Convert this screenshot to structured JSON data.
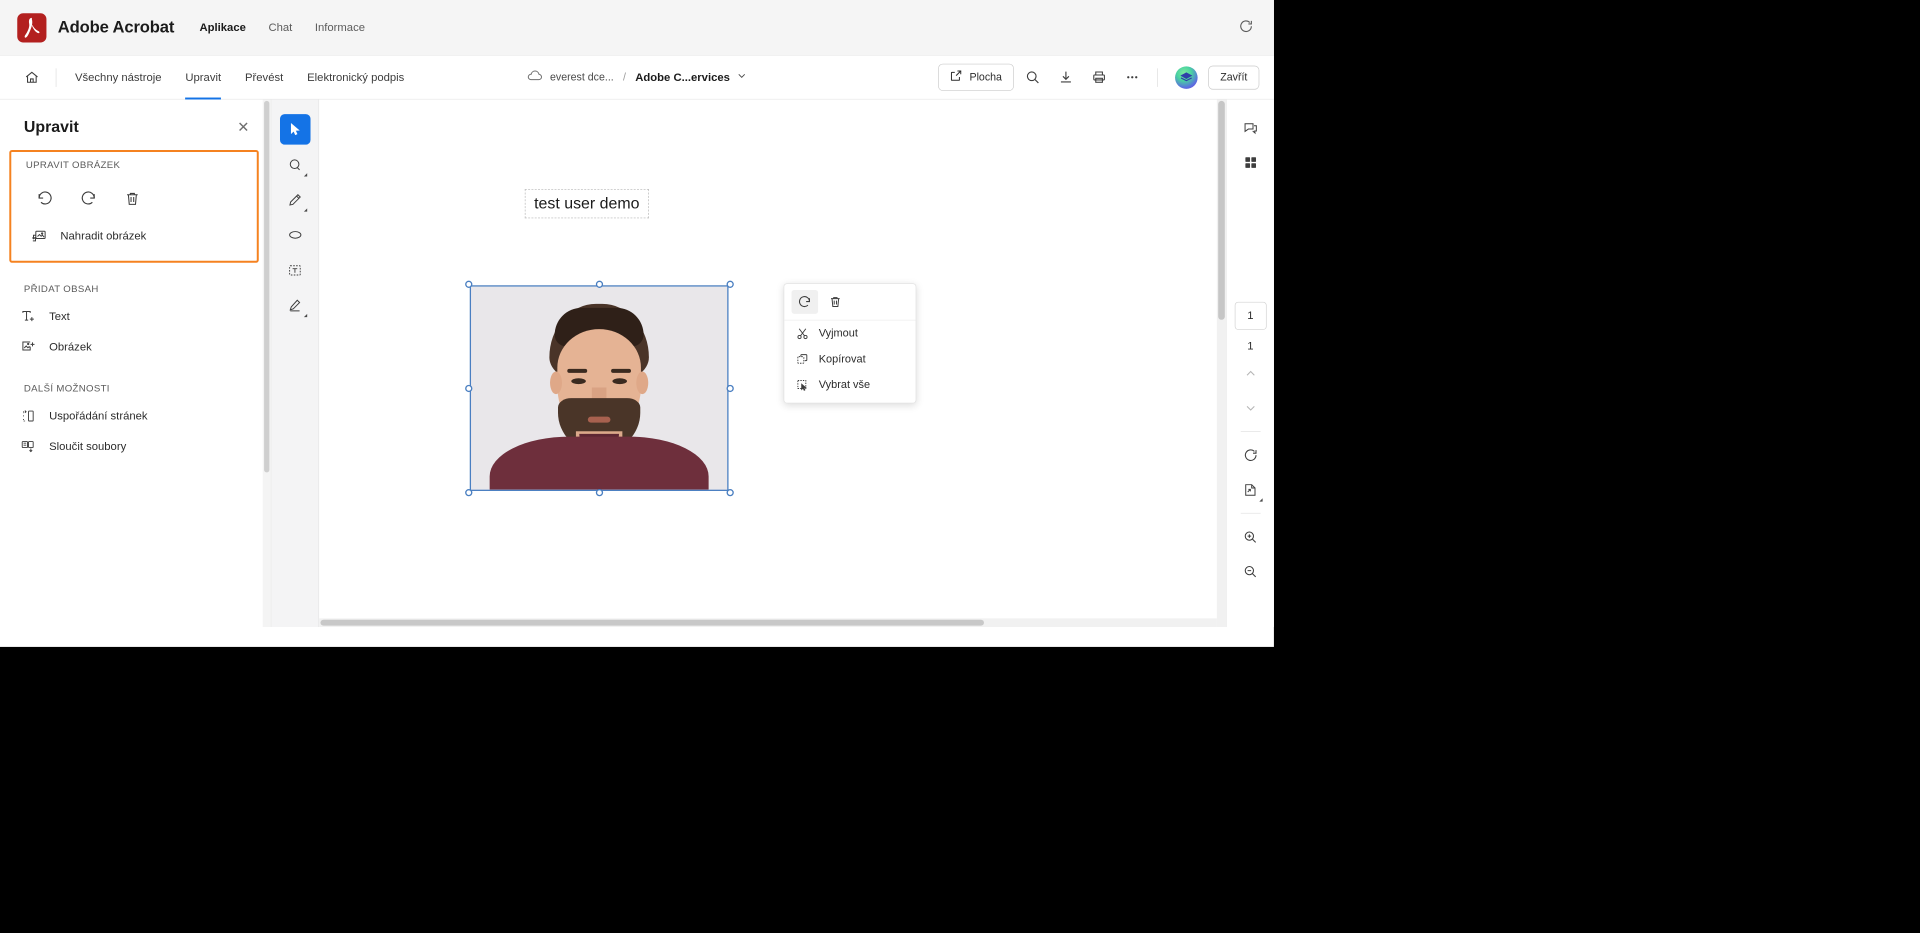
{
  "brand": {
    "logo_icon": "acrobat-logo-icon",
    "title": "Adobe Acrobat",
    "tabs": [
      {
        "label": "Aplikace",
        "active": true
      },
      {
        "label": "Chat",
        "active": false
      },
      {
        "label": "Informace",
        "active": false
      }
    ],
    "refresh_icon": "refresh-icon"
  },
  "toolbar": {
    "home_icon": "home-icon",
    "menu": [
      {
        "label": "Všechny nástroje",
        "active": false
      },
      {
        "label": "Upravit",
        "active": true
      },
      {
        "label": "Převést",
        "active": false
      },
      {
        "label": "Elektronický podpis",
        "active": false
      }
    ],
    "cloud_icon": "cloud-icon",
    "cloud_name": "everest dce...",
    "separator": "/",
    "doc_name": "Adobe C...ervices",
    "doc_caret_icon": "chevron-down-icon",
    "desktop_button": {
      "label": "Plocha",
      "icon": "open-external-icon"
    },
    "search_icon": "search-icon",
    "download_icon": "download-icon",
    "print_icon": "print-icon",
    "more_icon": "more-horizontal-icon",
    "avatar_icon": "user-avatar",
    "close_button": "Zavřít"
  },
  "left_panel": {
    "title": "Upravit",
    "close_icon": "close-icon",
    "highlighted_section": {
      "label": "UPRAVIT OBRÁZEK",
      "icon_buttons": [
        {
          "name": "rotate-left-icon",
          "title": "Otočit doleva"
        },
        {
          "name": "rotate-right-icon",
          "title": "Otočit doprava"
        },
        {
          "name": "trash-icon",
          "title": "Odstranit"
        }
      ],
      "replace_item": {
        "label": "Nahradit obrázek",
        "icon": "replace-image-icon"
      },
      "highlight_color": "#f58220"
    },
    "sections": [
      {
        "label": "PŘIDAT OBSAH",
        "items": [
          {
            "label": "Text",
            "icon": "add-text-icon"
          },
          {
            "label": "Obrázek",
            "icon": "add-image-icon"
          }
        ]
      },
      {
        "label": "DALŠÍ MOŽNOSTI",
        "items": [
          {
            "label": "Uspořádání stránek",
            "icon": "organize-pages-icon"
          },
          {
            "label": "Sloučit soubory",
            "icon": "combine-files-icon"
          }
        ]
      }
    ]
  },
  "tool_strip": [
    {
      "name": "select-tool-icon",
      "active": true,
      "caret": false
    },
    {
      "name": "comment-tool-icon",
      "active": false,
      "caret": true
    },
    {
      "name": "draw-tool-icon",
      "active": false,
      "caret": true
    },
    {
      "name": "shape-tool-icon",
      "active": false,
      "caret": false
    },
    {
      "name": "text-box-tool-icon",
      "active": false,
      "caret": false
    },
    {
      "name": "stamp-tool-icon",
      "active": false,
      "caret": true
    }
  ],
  "document": {
    "text_field_value": "test user demo",
    "image_selected": true,
    "selection_color": "#4a7fc1"
  },
  "context_menu": {
    "top_actions": [
      {
        "name": "rotate-right-icon",
        "hovered": true
      },
      {
        "name": "trash-icon",
        "hovered": false
      }
    ],
    "items": [
      {
        "label": "Vyjmout",
        "icon": "cut-icon"
      },
      {
        "label": "Kopírovat",
        "icon": "copy-icon"
      },
      {
        "label": "Vybrat vše",
        "icon": "select-all-icon"
      }
    ]
  },
  "right_rail": {
    "top_buttons": [
      {
        "name": "comments-panel-icon"
      },
      {
        "name": "thumbnails-panel-icon"
      }
    ],
    "current_page": "1",
    "total_pages": "1",
    "prev_page_icon": "chevron-up-icon",
    "next_page_icon": "chevron-down-icon",
    "rotate_icon": "rotate-view-icon",
    "fit_page_icon": "fit-page-icon",
    "zoom_in_icon": "zoom-in-icon",
    "zoom_out_icon": "zoom-out-icon"
  }
}
